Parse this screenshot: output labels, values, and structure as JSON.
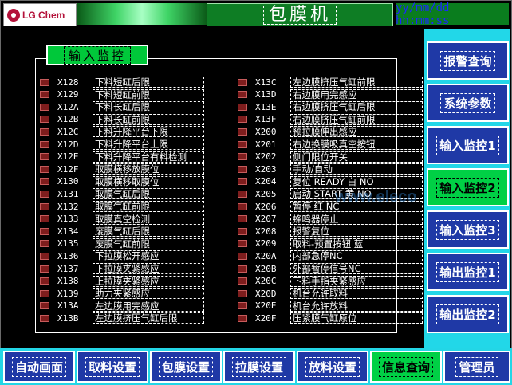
{
  "header": {
    "logo_text": "LG Chem",
    "title": "包膜机",
    "datetime": "yy/mm/dd hh:mm:ss"
  },
  "panel": {
    "title": "输入监控",
    "left_items": [
      {
        "addr": "X128",
        "label": "下料短缸后限"
      },
      {
        "addr": "X129",
        "label": "下料短缸前限"
      },
      {
        "addr": "X12A",
        "label": "下料长缸后限"
      },
      {
        "addr": "X12B",
        "label": "下料长缸前限"
      },
      {
        "addr": "X12C",
        "label": "下料升降平台下限"
      },
      {
        "addr": "X12D",
        "label": "下料升降平台上限"
      },
      {
        "addr": "X12E",
        "label": "下料升降平台有料检测"
      },
      {
        "addr": "X12F",
        "label": "取膜横移放膜位"
      },
      {
        "addr": "X130",
        "label": "取膜横移取膜位"
      },
      {
        "addr": "X131",
        "label": "取膜气缸后限"
      },
      {
        "addr": "X132",
        "label": "取膜气缸前限"
      },
      {
        "addr": "X133",
        "label": "取膜真空检测"
      },
      {
        "addr": "X134",
        "label": "废膜气缸后限"
      },
      {
        "addr": "X135",
        "label": "废膜气缸前限"
      },
      {
        "addr": "X136",
        "label": "下拉膜松开感应"
      },
      {
        "addr": "X137",
        "label": "下拉膜夹紧感应"
      },
      {
        "addr": "X138",
        "label": "上拉膜夹紧感应"
      },
      {
        "addr": "X139",
        "label": "助力夹紧感应"
      },
      {
        "addr": "X13A",
        "label": "左边膜用完感应"
      },
      {
        "addr": "X13B",
        "label": "左边膜挤压气缸后限"
      }
    ],
    "right_items": [
      {
        "addr": "X13C",
        "label": "左边膜挤压气缸前限"
      },
      {
        "addr": "X13D",
        "label": "右边膜用完感应"
      },
      {
        "addr": "X13E",
        "label": "右边膜挤压气缸后限"
      },
      {
        "addr": "X13F",
        "label": "右边膜挤压气缸前限"
      },
      {
        "addr": "X200",
        "label": "预拉膜伸出感应"
      },
      {
        "addr": "X201",
        "label": "右边换膜吸真空按钮"
      },
      {
        "addr": "X202",
        "label": "侧门限位开关"
      },
      {
        "addr": "X203",
        "label": "手动/自动"
      },
      {
        "addr": "X204",
        "label": "复位 READY 白 NO"
      },
      {
        "addr": "X205",
        "label": "启动 START 黄 NO"
      },
      {
        "addr": "X206",
        "label": "暂停 红 NC"
      },
      {
        "addr": "X207",
        "label": "蜂鸣器停止"
      },
      {
        "addr": "X208",
        "label": "报警复位"
      },
      {
        "addr": "X209",
        "label": "取料-预置按钮 蓝"
      },
      {
        "addr": "X20A",
        "label": "内部急停NC"
      },
      {
        "addr": "X20B",
        "label": "外部暂停信号NC"
      },
      {
        "addr": "X20C",
        "label": "下料手指夹紧感应"
      },
      {
        "addr": "X20D",
        "label": "机台允许取料"
      },
      {
        "addr": "X20E",
        "label": "机台允许放料"
      },
      {
        "addr": "X20F",
        "label": "压紧膜气缸原位"
      }
    ]
  },
  "side_menu": [
    {
      "label": "报警查询",
      "active": false
    },
    {
      "label": "系统参数",
      "active": false
    },
    {
      "label": "输入监控1",
      "active": false
    },
    {
      "label": "输入监控2",
      "active": true
    },
    {
      "label": "输入监控3",
      "active": false
    },
    {
      "label": "输出监控1",
      "active": false
    },
    {
      "label": "输出监控2",
      "active": false
    }
  ],
  "bottom_tabs": [
    {
      "label": "自动画面",
      "active": false
    },
    {
      "label": "取料设置",
      "active": false
    },
    {
      "label": "包膜设置",
      "active": false
    },
    {
      "label": "拉膜设置",
      "active": false
    },
    {
      "label": "放料设置",
      "active": false
    },
    {
      "label": "信息查询",
      "active": true
    },
    {
      "label": "管理员",
      "active": false
    }
  ],
  "watermark": "www.eleco",
  "colors": {
    "button_blue": "#1f39a6",
    "active_green": "#00d045",
    "cyan_bg": "#22d7e8",
    "led_off": "#7e1d1d"
  }
}
